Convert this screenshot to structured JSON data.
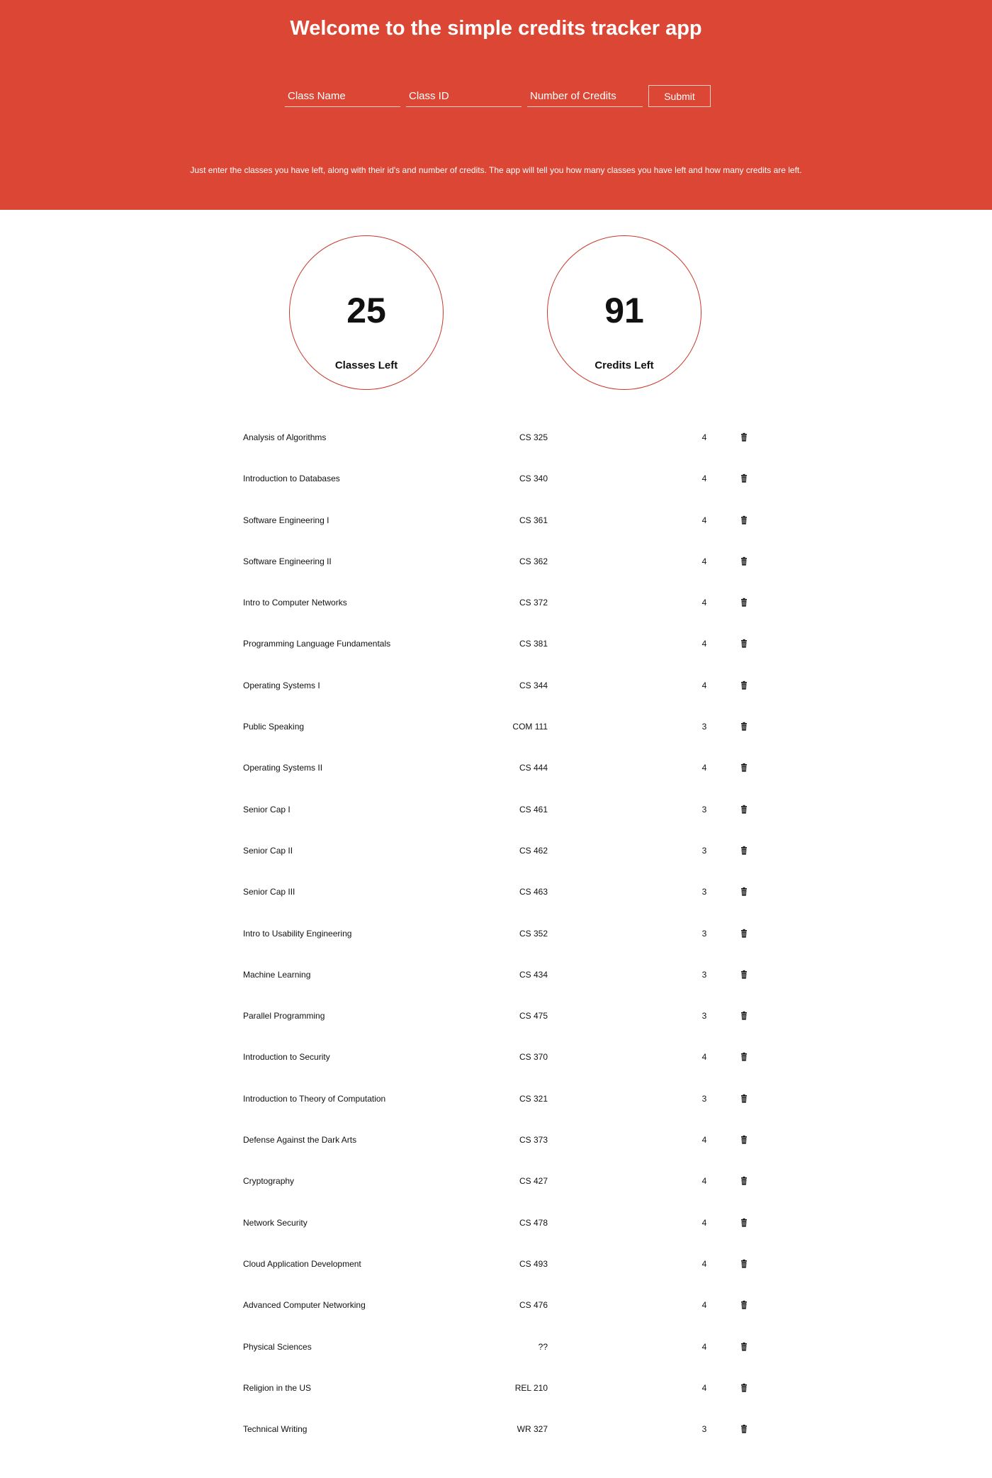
{
  "header": {
    "title": "Welcome to the simple credits tracker app",
    "intro": "Just enter the classes you have left, along with their id's and number of credits. The app will tell you how many classes you have left and how many credits are left."
  },
  "form": {
    "class_name_placeholder": "Class Name",
    "class_id_placeholder": "Class ID",
    "credits_placeholder": "Number of Credits",
    "submit_label": "Submit"
  },
  "summary": {
    "classes_left": "25",
    "classes_left_label": "Classes Left",
    "credits_left": "91",
    "credits_left_label": "Credits Left"
  },
  "accent_color": "#dc4735",
  "delete_icon": "trash-icon",
  "classes": [
    {
      "name": "Analysis of Algorithms",
      "id": "CS 325",
      "credits": "4"
    },
    {
      "name": "Introduction to Databases",
      "id": "CS 340",
      "credits": "4"
    },
    {
      "name": "Software Engineering I",
      "id": "CS 361",
      "credits": "4"
    },
    {
      "name": "Software Engineering II",
      "id": "CS 362",
      "credits": "4"
    },
    {
      "name": "Intro to Computer Networks",
      "id": "CS 372",
      "credits": "4"
    },
    {
      "name": "Programming Language Fundamentals",
      "id": "CS 381",
      "credits": "4"
    },
    {
      "name": "Operating Systems I",
      "id": "CS 344",
      "credits": "4"
    },
    {
      "name": "Public Speaking",
      "id": "COM 111",
      "credits": "3"
    },
    {
      "name": "Operating Systems II",
      "id": "CS 444",
      "credits": "4"
    },
    {
      "name": "Senior Cap I",
      "id": "CS 461",
      "credits": "3"
    },
    {
      "name": "Senior Cap II",
      "id": "CS 462",
      "credits": "3"
    },
    {
      "name": "Senior Cap III",
      "id": "CS 463",
      "credits": "3"
    },
    {
      "name": "Intro to Usability Engineering",
      "id": "CS 352",
      "credits": "3"
    },
    {
      "name": "Machine Learning",
      "id": "CS 434",
      "credits": "3"
    },
    {
      "name": "Parallel Programming",
      "id": "CS 475",
      "credits": "3"
    },
    {
      "name": "Introduction to Security",
      "id": "CS 370",
      "credits": "4"
    },
    {
      "name": "Introduction to Theory of Computation",
      "id": "CS 321",
      "credits": "3"
    },
    {
      "name": "Defense Against the Dark Arts",
      "id": "CS 373",
      "credits": "4"
    },
    {
      "name": "Cryptography",
      "id": "CS 427",
      "credits": "4"
    },
    {
      "name": "Network Security",
      "id": "CS 478",
      "credits": "4"
    },
    {
      "name": "Cloud Application Development",
      "id": "CS 493",
      "credits": "4"
    },
    {
      "name": "Advanced Computer Networking",
      "id": "CS 476",
      "credits": "4"
    },
    {
      "name": "Physical Sciences",
      "id": "??",
      "credits": "4"
    },
    {
      "name": "Religion in the US",
      "id": "REL 210",
      "credits": "4"
    },
    {
      "name": "Technical Writing",
      "id": "WR 327",
      "credits": "3"
    }
  ]
}
